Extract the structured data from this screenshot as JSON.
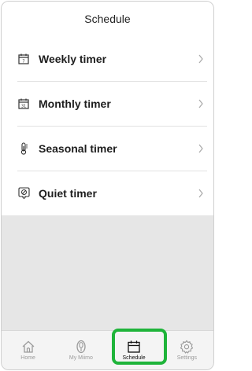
{
  "header": {
    "title": "Schedule"
  },
  "menu": {
    "items": [
      {
        "label": "Weekly timer",
        "icon": "calendar-7-icon"
      },
      {
        "label": "Monthly timer",
        "icon": "calendar-31-icon"
      },
      {
        "label": "Seasonal timer",
        "icon": "thermometer-icon"
      },
      {
        "label": "Quiet timer",
        "icon": "quiet-icon"
      }
    ],
    "icon_texts": {
      "weekly": "7",
      "monthly": "31"
    }
  },
  "tabbar": {
    "tabs": [
      {
        "label": "Home",
        "icon": "home-icon"
      },
      {
        "label": "My Miimo",
        "icon": "mower-icon"
      },
      {
        "label": "Schedule",
        "icon": "calendar-icon",
        "active": true
      },
      {
        "label": "Settings",
        "icon": "gear-icon"
      }
    ]
  },
  "colors": {
    "highlight": "#1fb43a",
    "inactive_tab": "#9b9b9b"
  }
}
